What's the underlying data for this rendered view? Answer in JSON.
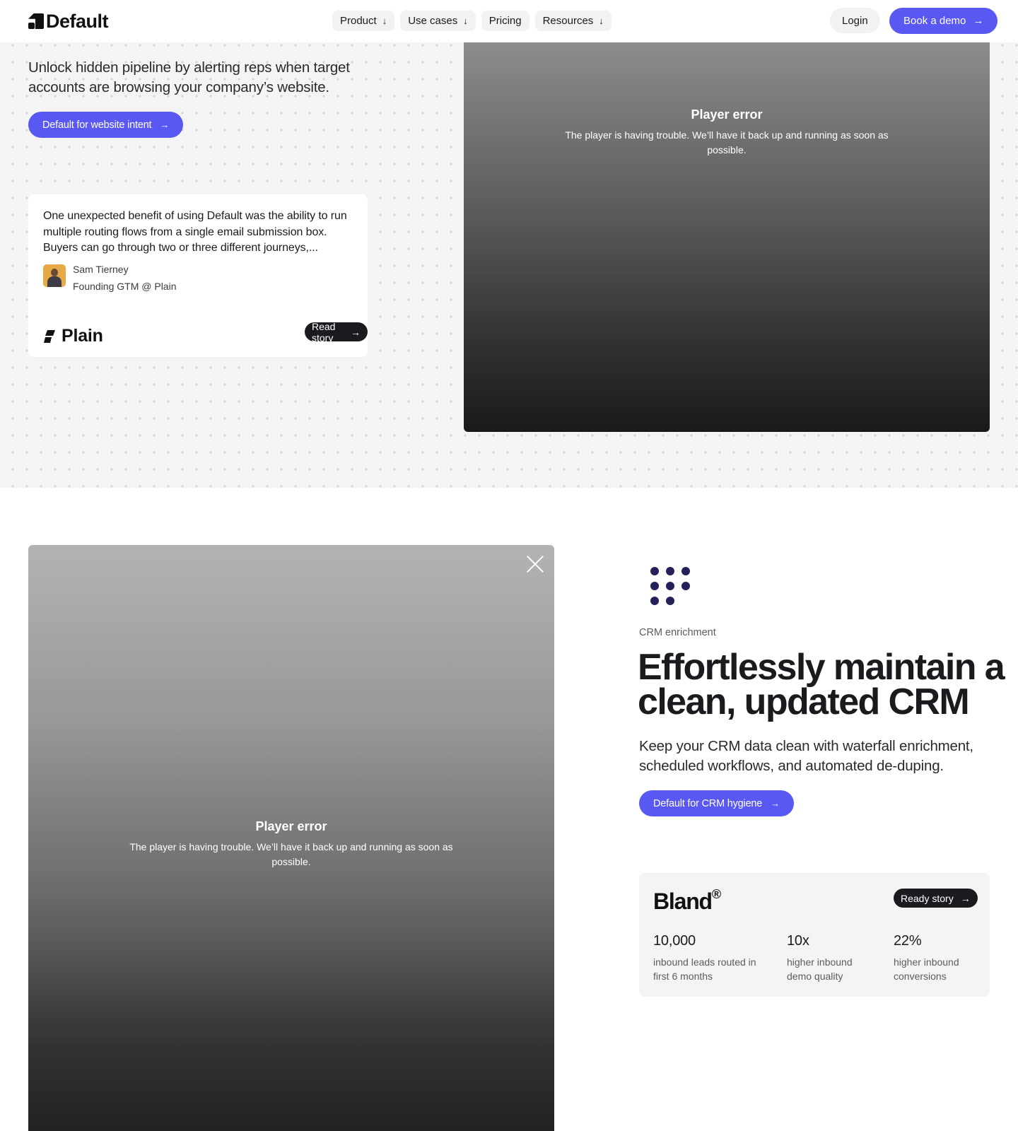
{
  "nav": {
    "logo_text": "Default",
    "items": [
      {
        "label": "Product",
        "has_dropdown": true
      },
      {
        "label": "Use cases",
        "has_dropdown": true
      },
      {
        "label": "Pricing",
        "has_dropdown": false
      },
      {
        "label": "Resources",
        "has_dropdown": true
      }
    ],
    "login_label": "Login",
    "demo_label": "Book a demo",
    "arrow": "→",
    "down_arrow": "↓",
    "accent_color": "#5a58f2"
  },
  "website_intent": {
    "subtitle": "Unlock hidden pipeline by alerting reps when target accounts are browsing your company’s website.",
    "button_label": "Default for website intent",
    "testimonial": {
      "quote": "One unexpected benefit of using Default was the ability to run multiple routing flows from a single email submission box. Buyers can go through two or three different journeys,...",
      "author_name": "Sam Tierney",
      "author_role": "Founding GTM @ Plain",
      "company_logo": "Plain",
      "story_label": "Read story"
    }
  },
  "players": [
    {
      "title": "Player error",
      "message": "The player is having trouble. We’ll have it back up and running as soon as possible."
    },
    {
      "title": "Player error",
      "message": "The player is having trouble. We’ll have it back up and running as soon as possible."
    }
  ],
  "crm": {
    "eyebrow": "CRM enrichment",
    "heading": "Effortlessly maintain a clean, updated CRM",
    "subtitle": "Keep your CRM data clean with waterfall enrichment, scheduled workflows, and automated de-duping.",
    "button_label": "Default for CRM hygiene",
    "icon": "dots-grid-icon",
    "icon_color": "#24215a",
    "case_study": {
      "company_logo": "Bland",
      "logo_mark": "®",
      "story_label": "Ready story",
      "stats": [
        {
          "value": "10,000",
          "label": "inbound leads routed in first 6 months"
        },
        {
          "value": "10x",
          "label": "higher inbound demo quality"
        },
        {
          "value": "22%",
          "label": "higher inbound conversions"
        }
      ]
    }
  }
}
